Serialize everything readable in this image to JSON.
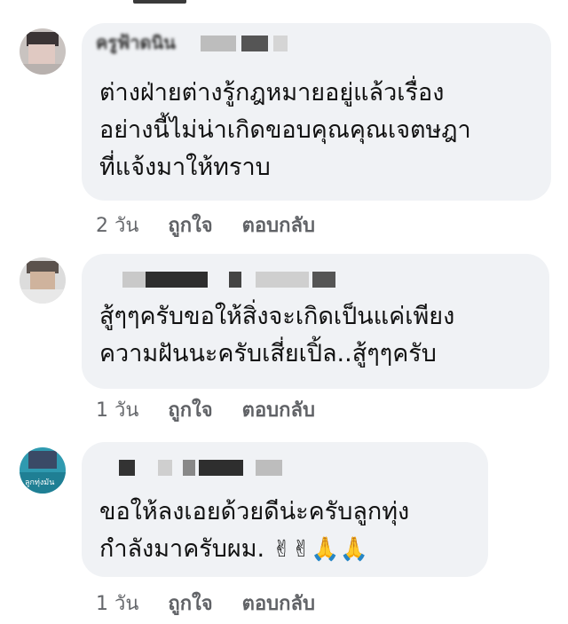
{
  "comments": [
    {
      "author_name": "ครูฟ้าดนิน",
      "text_lines": [
        "ต่างฝ่ายต่างรู้กฎหมายอยู่แล้วเรื่อง",
        "อย่างนี้ไม่น่าเกิดขอบคุณคุณเจตษฎา",
        "ที่แจ้งมาให้ทราบ"
      ],
      "time": "2 วัน",
      "like_label": "ถูกใจ",
      "reply_label": "ตอบกลับ"
    },
    {
      "author_name": "",
      "text_lines": [
        "สู้ๆๆครับขอให้สิ่งจะเกิดเป็นแค่เพียง",
        "ความฝันนะครับเสี่ยเปิ้ล..สู้ๆๆครับ"
      ],
      "time": "1 วัน",
      "like_label": "ถูกใจ",
      "reply_label": "ตอบกลับ"
    },
    {
      "author_name": "",
      "text_lines": [
        "ขอให้ลงเอยด้วยดีน่ะครับลูกทุ่ง",
        "กำลังมาครับผม."
      ],
      "emojis": "✌✌🙏🙏",
      "avatar_caption": "ลูกทุ่งมัน",
      "time": "1 วัน",
      "like_label": "ถูกใจ",
      "reply_label": "ตอบกลับ"
    }
  ]
}
